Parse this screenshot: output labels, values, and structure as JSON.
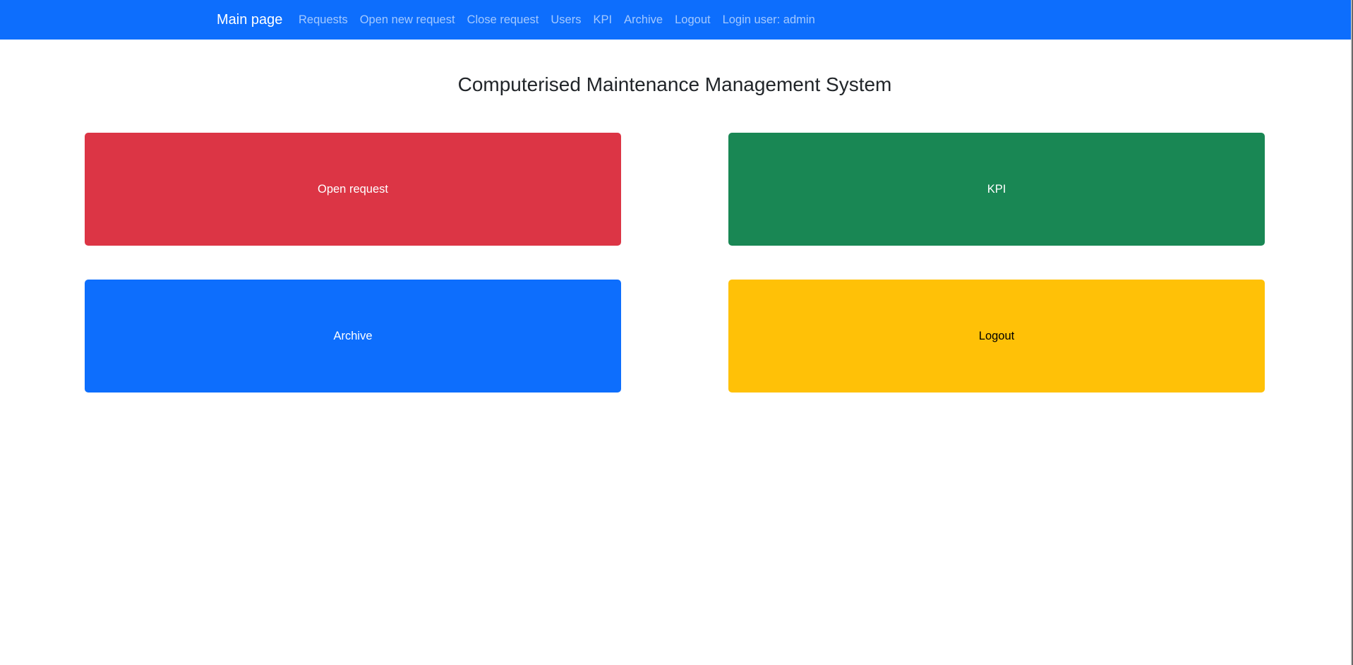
{
  "navbar": {
    "brand": "Main page",
    "links": [
      {
        "label": "Requests"
      },
      {
        "label": "Open new request"
      },
      {
        "label": "Close request"
      },
      {
        "label": "Users"
      },
      {
        "label": "KPI"
      },
      {
        "label": "Archive"
      },
      {
        "label": "Logout"
      }
    ],
    "login_user": "Login user: admin",
    "background_color": "#0d6efd"
  },
  "main": {
    "title": "Computerised Maintenance Management System",
    "tiles": [
      {
        "label": "Open request",
        "color": "#dc3545",
        "text_color": "#ffffff"
      },
      {
        "label": "KPI",
        "color": "#198754",
        "text_color": "#ffffff"
      },
      {
        "label": "Archive",
        "color": "#0d6efd",
        "text_color": "#ffffff"
      },
      {
        "label": "Logout",
        "color": "#ffc107",
        "text_color": "#000000"
      }
    ]
  }
}
